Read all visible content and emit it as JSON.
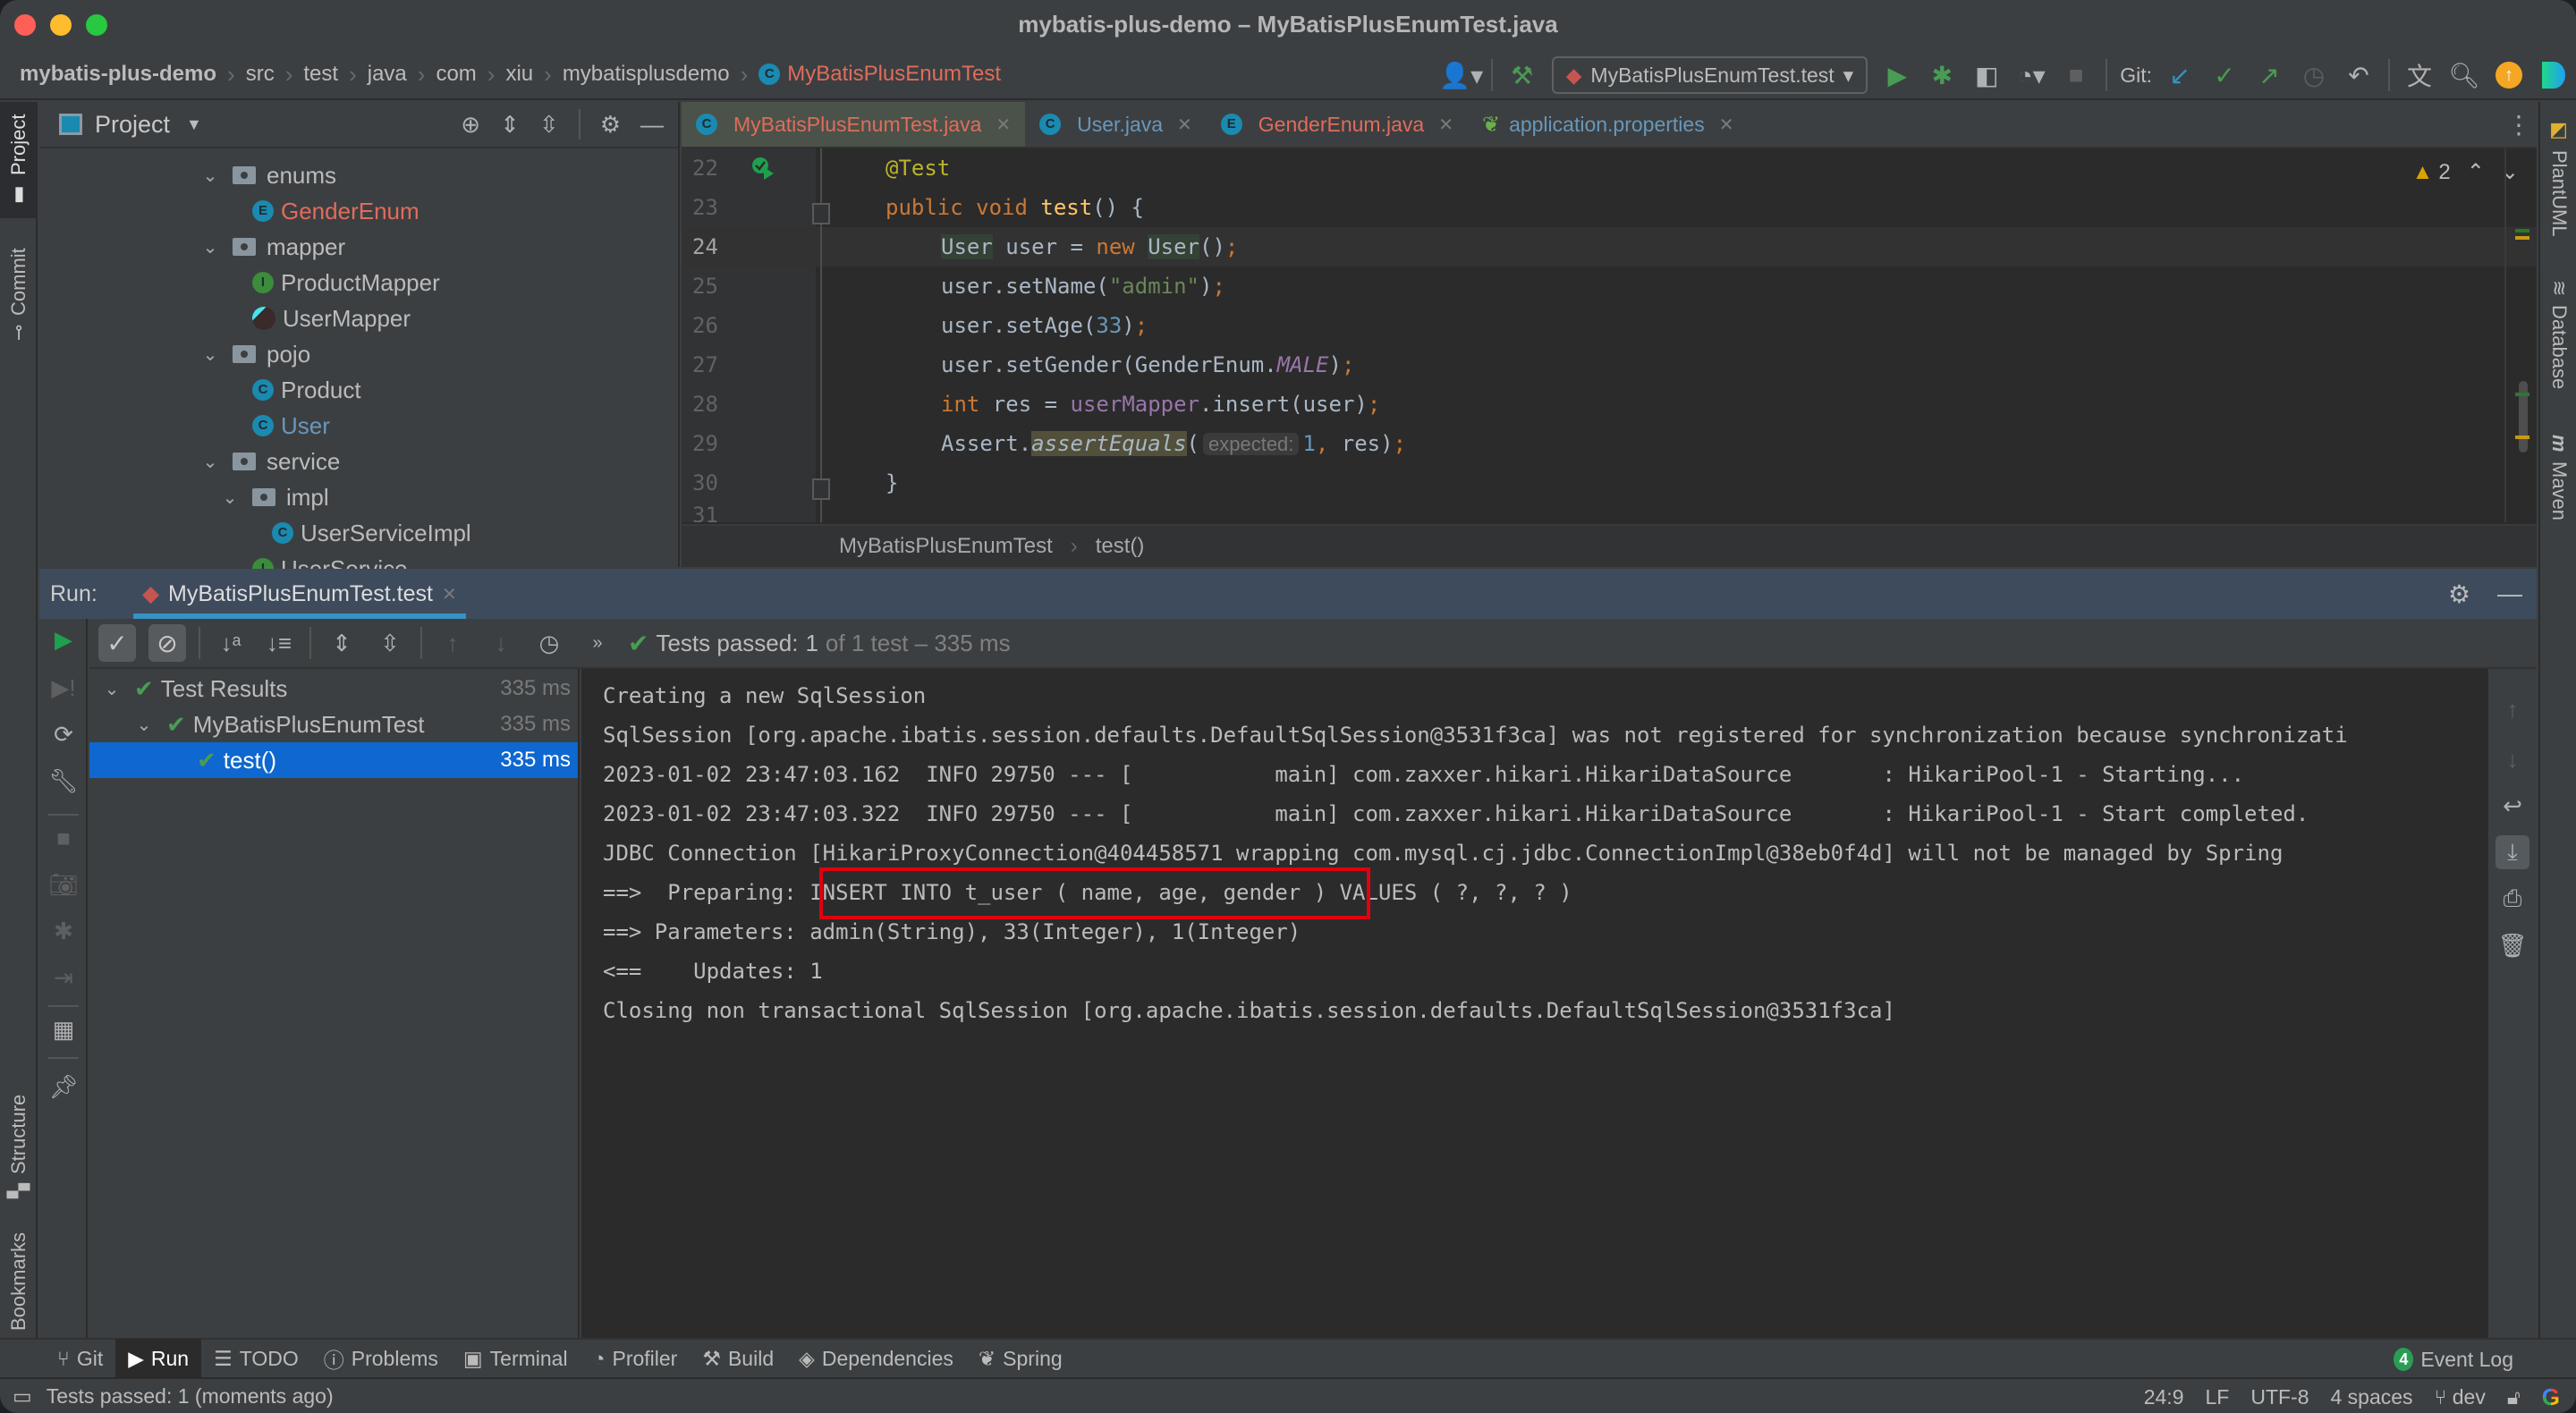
{
  "window": {
    "title": "mybatis-plus-demo – MyBatisPlusEnumTest.java"
  },
  "breadcrumb": {
    "items": [
      "mybatis-plus-demo",
      "src",
      "test",
      "java",
      "com",
      "xiu",
      "mybatisplusdemo"
    ],
    "active": "MyBatisPlusEnumTest"
  },
  "toolbar": {
    "run_config": "MyBatisPlusEnumTest.test",
    "git_label": "Git:",
    "icons": [
      "user-icon",
      "build-hammer-icon",
      "run-icon",
      "debug-icon",
      "coverage-icon",
      "profile-icon",
      "stop-icon",
      "git-update-icon",
      "git-commit-icon",
      "git-push-icon",
      "history-icon",
      "rollback-icon",
      "translate-icon",
      "search-icon",
      "update-icon",
      "jetbrains-icon"
    ]
  },
  "left_strip": {
    "tabs": [
      "Project",
      "Commit",
      "Structure",
      "Bookmarks"
    ]
  },
  "right_strip": {
    "tabs": [
      "PlantUML",
      "Database",
      "Maven"
    ]
  },
  "project": {
    "title": "Project",
    "tree": [
      {
        "label": "enums",
        "type": "folder",
        "depth": 0,
        "expanded": true
      },
      {
        "label": "GenderEnum",
        "type": "enum",
        "depth": 1,
        "color": "red"
      },
      {
        "label": "mapper",
        "type": "folder",
        "depth": 0,
        "expanded": true
      },
      {
        "label": "ProductMapper",
        "type": "interface",
        "depth": 1
      },
      {
        "label": "UserMapper",
        "type": "mybatis",
        "depth": 1
      },
      {
        "label": "pojo",
        "type": "folder",
        "depth": 0,
        "expanded": true
      },
      {
        "label": "Product",
        "type": "class",
        "depth": 1
      },
      {
        "label": "User",
        "type": "class",
        "depth": 1,
        "color": "blue"
      },
      {
        "label": "service",
        "type": "folder",
        "depth": 0,
        "expanded": true
      },
      {
        "label": "impl",
        "type": "folder",
        "depth": 1,
        "expanded": true
      },
      {
        "label": "UserServiceImpl",
        "type": "class",
        "depth": 2
      },
      {
        "label": "UserService",
        "type": "interface",
        "depth": 1
      }
    ]
  },
  "editor": {
    "tabs": [
      {
        "label": "MyBatisPlusEnumTest.java",
        "icon": "C",
        "color": "#e06c5b",
        "active": true
      },
      {
        "label": "User.java",
        "icon": "C",
        "color": "#6897bb"
      },
      {
        "label": "GenderEnum.java",
        "icon": "E",
        "color": "#e06c5b"
      },
      {
        "label": "application.properties",
        "icon": "spring",
        "color": "#6897bb"
      }
    ],
    "line_numbers": [
      "22",
      "23",
      "24",
      "25",
      "26",
      "27",
      "28",
      "29",
      "30",
      "31"
    ],
    "current_line": "24",
    "code": {
      "l22": "@Test",
      "l23_kw1": "public",
      "l23_kw2": "void",
      "l23_fn": "test",
      "l23_rest": "() {",
      "l24_type1": "User",
      "l24_mid": " user = ",
      "l24_new": "new",
      "l24_type2": "User",
      "l24_end": "()",
      "l25_a": "user.setName(",
      "l25_str": "\"admin\"",
      "l25_b": ")",
      "l26_a": "user.setAge(",
      "l26_num": "33",
      "l26_b": ")",
      "l27_a": "user.setGender(GenderEnum.",
      "l27_const": "MALE",
      "l27_b": ")",
      "l28_kw": "int",
      "l28_a": " res = ",
      "l28_field": "userMapper",
      "l28_b": ".insert(user)",
      "l29_a": "Assert.",
      "l29_call": "assertEquals",
      "l29_paren": "(",
      "l29_hint": "expected:",
      "l29_num": "1",
      "l29_b": " res)",
      "l30": "}",
      "semicolon": ";",
      "comma": ","
    },
    "warnings_count": "2",
    "breadcrumb": [
      "MyBatisPlusEnumTest",
      "test()"
    ]
  },
  "run_panel": {
    "label": "Run:",
    "tab": "MyBatisPlusEnumTest.test",
    "status_prefix": "Tests passed:",
    "status_count": "1",
    "status_suffix": "of 1 test – 335 ms",
    "results": [
      {
        "label": "Test Results",
        "time": "335 ms",
        "depth": 0
      },
      {
        "label": "MyBatisPlusEnumTest",
        "time": "335 ms",
        "depth": 1
      },
      {
        "label": "test()",
        "time": "335 ms",
        "depth": 2,
        "selected": true
      }
    ],
    "console": [
      "Creating a new SqlSession",
      "SqlSession [org.apache.ibatis.session.defaults.DefaultSqlSession@3531f3ca] was not registered for synchronization because synchronizati",
      "2023-01-02 23:47:03.162  INFO 29750 --- [           main] com.zaxxer.hikari.HikariDataSource       : HikariPool-1 - Starting...",
      "2023-01-02 23:47:03.322  INFO 29750 --- [           main] com.zaxxer.hikari.HikariDataSource       : HikariPool-1 - Start completed.",
      "JDBC Connection [HikariProxyConnection@404458571 wrapping com.mysql.cj.jdbc.ConnectionImpl@38eb0f4d] will not be managed by Spring",
      "==>  Preparing: INSERT INTO t_user ( name, age, gender ) VALUES ( ?, ?, ? )",
      "==> Parameters: admin(String), 33(Integer), 1(Integer)",
      "<==    Updates: 1",
      "Closing non transactional SqlSession [org.apache.ibatis.session.defaults.DefaultSqlSession@3531f3ca]"
    ],
    "highlighted_sql": "INSERT INTO t_user ( name, age, gender ) VALUES ( ?, ?, ? )"
  },
  "bottom_bar": {
    "items": [
      "Git",
      "Run",
      "TODO",
      "Problems",
      "Terminal",
      "Profiler",
      "Build",
      "Dependencies",
      "Spring"
    ],
    "active": "Run",
    "event_log_count": "4",
    "event_log_label": "Event Log"
  },
  "status_bar": {
    "message": "Tests passed: 1 (moments ago)",
    "position": "24:9",
    "line_ending": "LF",
    "encoding": "UTF-8",
    "indent": "4 spaces",
    "branch": "dev"
  }
}
